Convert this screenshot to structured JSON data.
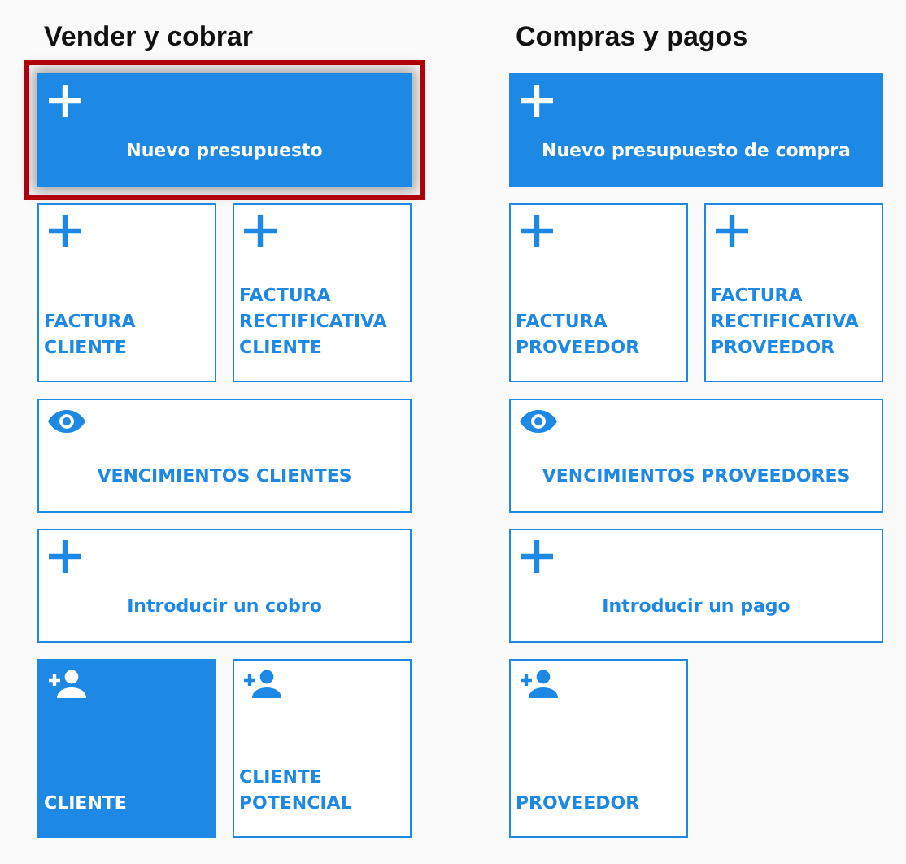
{
  "sections": [
    {
      "title": "Vender y cobrar",
      "tiles": [
        {
          "label": "Nuevo presupuesto",
          "kind": "plus",
          "filled": true,
          "wide": true,
          "highlighted": true
        },
        {
          "label": "FACTURA CLIENTE",
          "kind": "plus",
          "filled": false,
          "wide": false,
          "highlighted": false
        },
        {
          "label": "FACTURA RECTIFICATIVA CLIENTE",
          "kind": "plus",
          "filled": false,
          "wide": false,
          "highlighted": false
        },
        {
          "label": "VENCIMIENTOS CLIENTES",
          "kind": "eye",
          "filled": false,
          "wide": true,
          "highlighted": false
        },
        {
          "label": "Introducir un cobro",
          "kind": "plus",
          "filled": false,
          "wide": true,
          "highlighted": false
        },
        {
          "label": "CLIENTE",
          "kind": "person_add",
          "filled": true,
          "wide": false,
          "highlighted": false
        },
        {
          "label": "CLIENTE POTENCIAL",
          "kind": "person_add",
          "filled": false,
          "wide": false,
          "highlighted": false
        }
      ]
    },
    {
      "title": "Compras y pagos",
      "tiles": [
        {
          "label": "Nuevo presupuesto de compra",
          "kind": "plus",
          "filled": true,
          "wide": true,
          "highlighted": false
        },
        {
          "label": "FACTURA PROVEEDOR",
          "kind": "plus",
          "filled": false,
          "wide": false,
          "highlighted": false
        },
        {
          "label": "FACTURA RECTIFICATIVA PROVEEDOR",
          "kind": "plus",
          "filled": false,
          "wide": false,
          "highlighted": false
        },
        {
          "label": "VENCIMIENTOS PROVEEDORES",
          "kind": "eye",
          "filled": false,
          "wide": true,
          "highlighted": false
        },
        {
          "label": "Introducir un pago",
          "kind": "plus",
          "filled": false,
          "wide": true,
          "highlighted": false
        },
        {
          "label": "PROVEEDOR",
          "kind": "person_add",
          "filled": false,
          "wide": false,
          "highlighted": false
        }
      ]
    }
  ]
}
